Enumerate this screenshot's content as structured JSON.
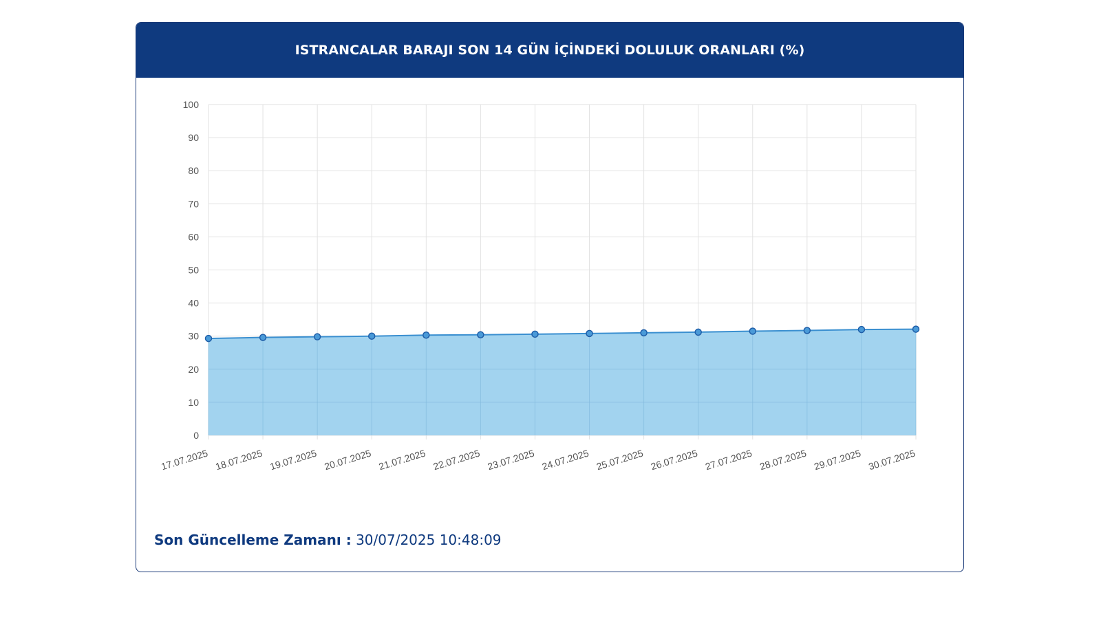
{
  "header": {
    "title": "ISTRANCALAR BARAJI SON 14 GÜN İÇİNDEKİ DOLULUK ORANLARI (%)"
  },
  "footer": {
    "label": "Son Güncelleme Zamanı :",
    "value": "30/07/2025 10:48:09"
  },
  "colors": {
    "header_bg": "#0f3a7f",
    "line": "#3a8fd0",
    "area_fill": "#9dd1ee",
    "point_fill": "#4a9ad8",
    "point_stroke": "#1f5ea8",
    "grid": "#e2e2e2",
    "tick_text": "#555555"
  },
  "chart_data": {
    "type": "area",
    "categories": [
      "17.07.2025",
      "18.07.2025",
      "19.07.2025",
      "20.07.2025",
      "21.07.2025",
      "22.07.2025",
      "23.07.2025",
      "24.07.2025",
      "25.07.2025",
      "26.07.2025",
      "27.07.2025",
      "28.07.2025",
      "29.07.2025",
      "30.07.2025"
    ],
    "values": [
      29.3,
      29.6,
      29.8,
      30.0,
      30.3,
      30.4,
      30.6,
      30.8,
      31.0,
      31.2,
      31.5,
      31.7,
      32.0,
      32.1
    ],
    "title": "ISTRANCALAR BARAJI SON 14 GÜN İÇİNDEKİ DOLULUK ORANLARI (%)",
    "xlabel": "",
    "ylabel": "",
    "ylim": [
      0,
      100
    ],
    "yticks": [
      0,
      10,
      20,
      30,
      40,
      50,
      60,
      70,
      80,
      90,
      100
    ],
    "grid": true,
    "legend": "none"
  }
}
